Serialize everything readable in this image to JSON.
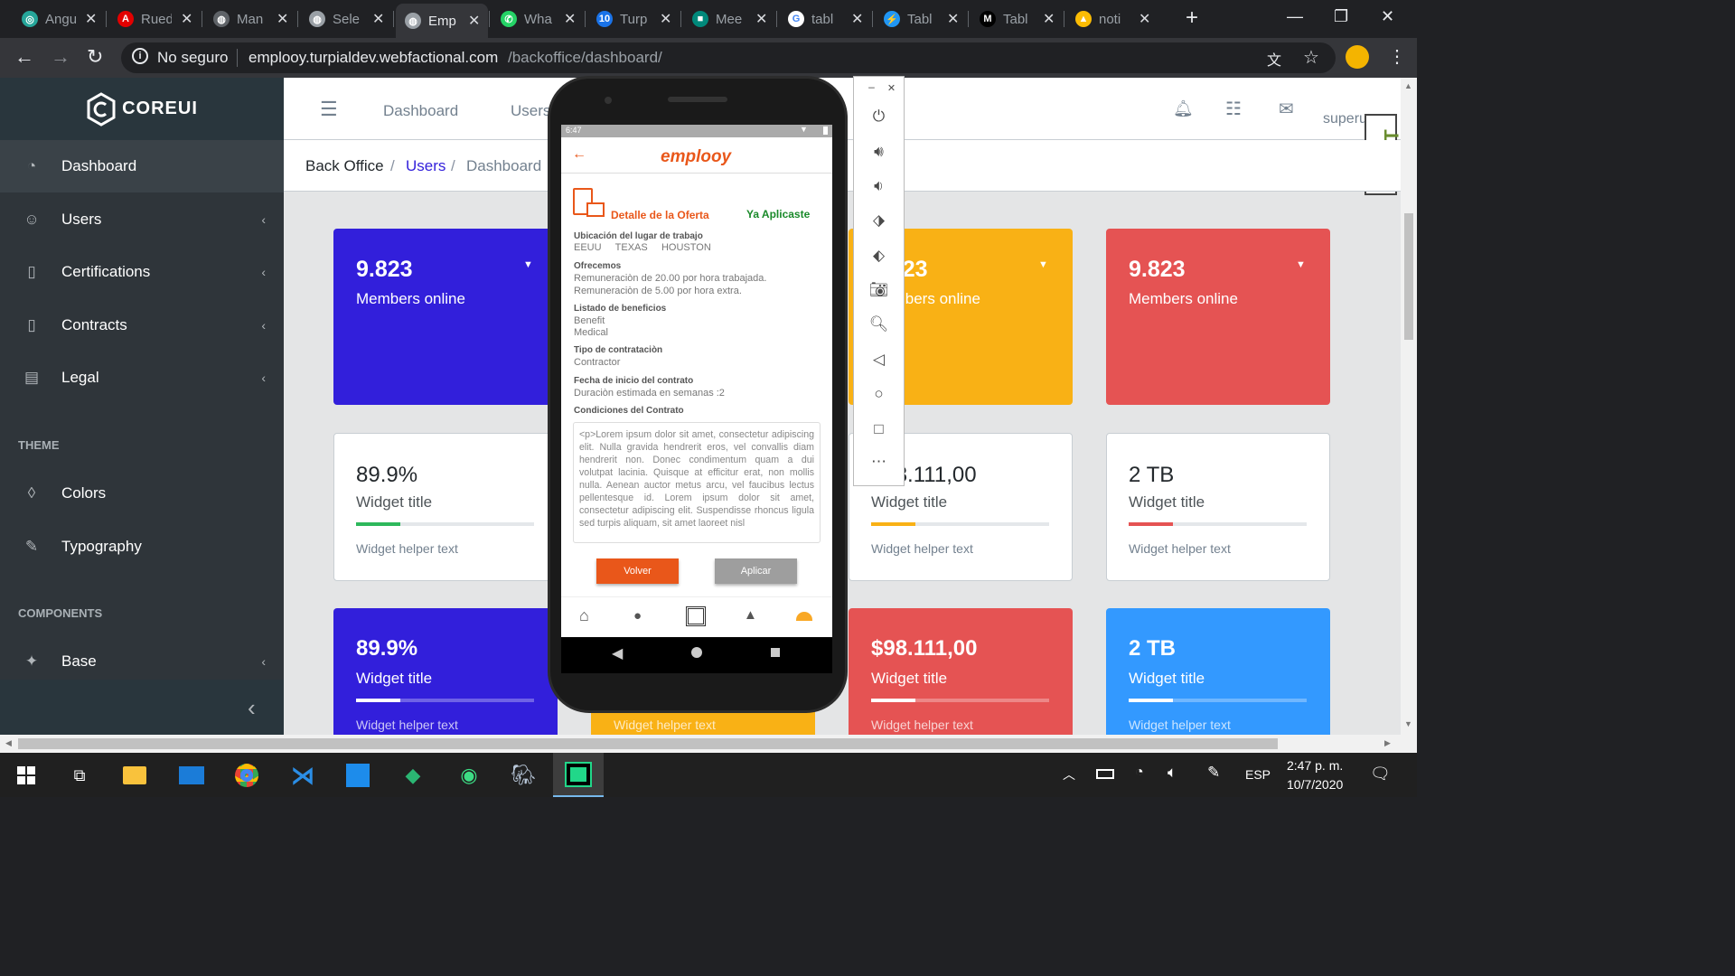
{
  "browser": {
    "tabs": [
      {
        "label": "Angu",
        "color": "#26a69a",
        "glyph": "◎"
      },
      {
        "label": "Rued",
        "color": "#e30000",
        "glyph": "A"
      },
      {
        "label": "Man",
        "color": "#5f6368",
        "glyph": "◍"
      },
      {
        "label": "Sele",
        "color": "#9aa0a6",
        "glyph": "◍"
      },
      {
        "label": "Emp",
        "color": "#9aa0a6",
        "glyph": "◍"
      },
      {
        "label": "Wha",
        "color": "#25d366",
        "glyph": "✆"
      },
      {
        "label": "Turp",
        "color": "#1a73e8",
        "glyph": "10"
      },
      {
        "label": "Mee",
        "color": "#00897b",
        "glyph": "■"
      },
      {
        "label": "tabl",
        "color": "#ffffff",
        "glyph": "G"
      },
      {
        "label": "Tabl",
        "color": "#2196f3",
        "glyph": "⚡"
      },
      {
        "label": "Tabl",
        "color": "#000000",
        "glyph": "M"
      },
      {
        "label": "noti",
        "color": "#fbbc04",
        "glyph": "▲"
      }
    ],
    "active_tab_index": 4,
    "new_tab": "+",
    "security": "No seguro",
    "url_host": "emplooy.turpialdev.webfactional.com",
    "url_path": "/backoffice/dashboard/"
  },
  "app": {
    "brand": "COREUI",
    "nav": [
      {
        "label": "Dashboard",
        "icon": "speedometer-icon",
        "active": true
      },
      {
        "label": "Users",
        "icon": "people-icon",
        "chevron": "‹"
      },
      {
        "label": "Certifications",
        "icon": "document-icon",
        "chevron": "‹"
      },
      {
        "label": "Contracts",
        "icon": "document-icon",
        "chevron": "‹"
      },
      {
        "label": "Legal",
        "icon": "book-icon",
        "chevron": "‹"
      }
    ],
    "section_theme": "THEME",
    "theme_items": [
      {
        "label": "Colors",
        "icon": "drop-icon"
      },
      {
        "label": "Typography",
        "icon": "pencil-icon"
      }
    ],
    "section_components": "COMPONENTS",
    "components_items": [
      {
        "label": "Base",
        "icon": "puzzle-icon",
        "chevron": "‹"
      }
    ],
    "minimizer": "‹",
    "header": {
      "links": [
        "Dashboard",
        "Users"
      ],
      "avatar_alt": "superuser"
    },
    "breadcrumb": [
      "Back Office",
      "/",
      "Users",
      "/",
      "Dashboard"
    ],
    "colors": {
      "primary": "#321fdb",
      "warning": "#f9b115",
      "danger": "#e55353",
      "info": "#39f",
      "success": "#2eb85c"
    }
  },
  "cards_row1": [
    {
      "value": "9.823",
      "label": "Members online",
      "color": "#321fdb",
      "caret": "▼"
    },
    {
      "value": "9.823",
      "label": "Members online",
      "color": "#f9b115",
      "caret": "▼"
    },
    {
      "value": "9.823",
      "label": "Members online",
      "color": "#e55353",
      "caret": "▼"
    }
  ],
  "cards_row2": [
    {
      "value": "89.9%",
      "title": "Widget title",
      "help": "Widget helper text",
      "progress": 0.25,
      "color": "#2eb85c"
    },
    {
      "value": "$98.111,00",
      "title": "Widget title",
      "help": "Widget helper text",
      "progress": 0.25,
      "color": "#f9b115"
    },
    {
      "value": "2 TB",
      "title": "Widget title",
      "help": "Widget helper text",
      "progress": 0.25,
      "color": "#e55353"
    }
  ],
  "cards_row3": [
    {
      "value": "89.9%",
      "title": "Widget title",
      "help": "Widget helper text",
      "progress": 0.25,
      "color": "#321fdb"
    },
    {
      "value": "",
      "title": "",
      "help": "Widget helper text",
      "progress": 0.25,
      "color": "#f9b115"
    },
    {
      "value": "$98.111,00",
      "title": "Widget title",
      "help": "Widget helper text",
      "progress": 0.25,
      "color": "#e55353"
    },
    {
      "value": "2 TB",
      "title": "Widget title",
      "help": "Widget helper text",
      "progress": 0.25,
      "color": "#39f"
    }
  ],
  "phone": {
    "time": "6:47",
    "logo": "emplooy",
    "title": "Detalle de la  Oferta",
    "status": "Ya Aplicaste",
    "sections": [
      {
        "heading": "Ubicación del lugar de trabajo",
        "lines": [
          "EEUU     TEXAS     HOUSTON"
        ]
      },
      {
        "heading": "Ofrecemos",
        "lines": [
          "Remuneraciòn de 20.00  por hora trabajada.",
          "Remuneraciòn de 5.00  por hora extra."
        ]
      },
      {
        "heading": "Listado de beneficios",
        "lines": [
          "Benefit",
          "Medical"
        ]
      },
      {
        "heading": "Tipo de contrataciòn",
        "lines": [
          "Contractor"
        ]
      },
      {
        "heading": "Fecha de inicio del contrato",
        "lines": [
          "Duraciòn estimada en semanas :2"
        ]
      },
      {
        "heading": "Condiciones del Contrato",
        "lines": []
      }
    ],
    "conditions": "<p>Lorem ipsum dolor sit amet, consectetur adipiscing elit. Nulla gravida hendrerit eros, vel convallis diam hendrerit non. Donec condimentum quam a dui volutpat lacinia. Quisque at efficitur erat, non mollis nulla. Aenean auctor metus arcu, vel faucibus lectus pellentesque id. Lorem ipsum dolor sit amet, consectetur adipiscing elit. Suspendisse rhoncus ligula sed turpis aliquam, sit amet laoreet nisl",
    "btn_back": "Volver",
    "btn_apply": "Aplicar"
  },
  "taskbar": {
    "lang": "ESP",
    "time": "2:47 p. m.",
    "date": "10/7/2020"
  }
}
